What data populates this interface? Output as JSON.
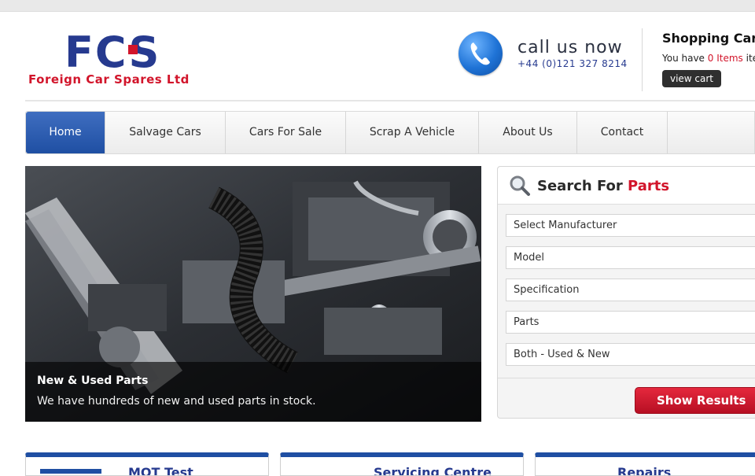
{
  "header": {
    "logo_main": "FCS",
    "logo_sub": "Foreign Car Spares Ltd",
    "call_label": "call us now",
    "phone_number": "+44 (0)121 327 8214",
    "cart": {
      "title": "Shopping Cart",
      "line_prefix": "You have ",
      "count_text": "0 Items",
      "line_suffix": " items",
      "button": "view cart"
    }
  },
  "nav": {
    "items": [
      {
        "label": "Home",
        "active": true
      },
      {
        "label": "Salvage Cars"
      },
      {
        "label": "Cars For Sale"
      },
      {
        "label": "Scrap A Vehicle"
      },
      {
        "label": "About Us"
      },
      {
        "label": "Contact"
      }
    ]
  },
  "hero": {
    "title": "New & Used Parts",
    "text": "We have hundreds of new and used parts in stock."
  },
  "search": {
    "title_prefix": "Search For ",
    "title_highlight": "Parts",
    "fields": [
      "Select Manufacturer",
      "Model",
      "Specification",
      "Parts",
      "Both - Used & New"
    ],
    "button": "Show Results"
  },
  "panels": [
    "MOT Test",
    "Servicing Centre",
    "Repairs"
  ],
  "colors": {
    "brand_blue": "#263a8f",
    "brand_red": "#d2152b",
    "nav_active": "#1f4fa3"
  }
}
